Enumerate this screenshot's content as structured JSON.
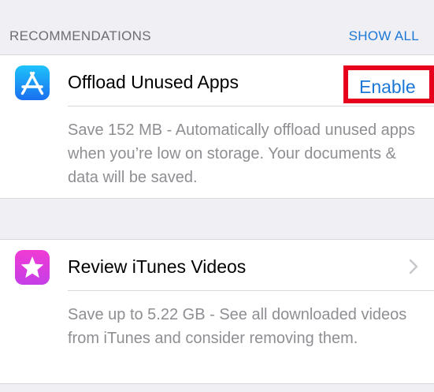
{
  "header": {
    "title": "RECOMMENDATIONS",
    "show_all_label": "SHOW ALL"
  },
  "recommendations": [
    {
      "icon": "app-store-icon",
      "title": "Offload Unused Apps",
      "action_label": "Enable",
      "description": "Save 152 MB - Automatically offload unused apps when you’re low on storage. Your documents & data will be saved."
    },
    {
      "icon": "itunes-star-icon",
      "title": "Review iTunes Videos",
      "action_label": "",
      "description": "Save up to 5.22 GB - See all downloaded videos from iTunes and consider removing them."
    }
  ],
  "colors": {
    "background": "#efeff4",
    "accent": "#1c78d6",
    "highlight": "#e6001c",
    "secondary_text": "#8e8e93",
    "section_header_text": "#6d6d72"
  }
}
